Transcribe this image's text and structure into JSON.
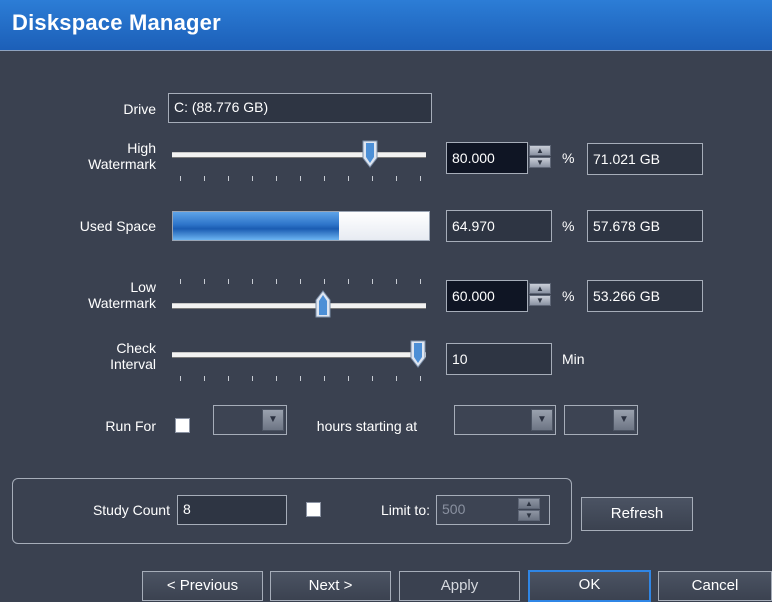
{
  "window": {
    "title": "Diskspace Manager"
  },
  "drive": {
    "label": "Drive",
    "value": "C: (88.776 GB)"
  },
  "high_watermark": {
    "label_line1": "High",
    "label_line2": "Watermark",
    "slider_value_percent": 80.0,
    "percent_value": "80.000",
    "percent_unit": "%",
    "size_value": "71.021 GB"
  },
  "used_space": {
    "label": "Used Space",
    "progress_percent": 64.97,
    "percent_value": "64.970",
    "percent_unit": "%",
    "size_value": "57.678 GB"
  },
  "low_watermark": {
    "label_line1": "Low",
    "label_line2": "Watermark",
    "slider_value_percent": 60.0,
    "percent_value": "60.000",
    "percent_unit": "%",
    "size_value": "53.266 GB"
  },
  "check_interval": {
    "label_line1": "Check",
    "label_line2": "Interval",
    "slider_value_fraction": 1.0,
    "value": "10",
    "unit": "Min"
  },
  "run_for": {
    "label": "Run For",
    "checked": false,
    "hours_label": "hours starting at"
  },
  "study_count": {
    "label": "Study Count",
    "value": "8",
    "limit_checked": false,
    "limit_label": "Limit to:",
    "limit_value": "500"
  },
  "buttons": {
    "refresh": "Refresh",
    "previous": "< Previous",
    "next": "Next >",
    "apply": "Apply",
    "ok": "OK",
    "cancel": "Cancel"
  },
  "colors": {
    "title_bar": "#1c5fb8",
    "background": "#3a4150",
    "ok_focus": "#2f86e6"
  }
}
